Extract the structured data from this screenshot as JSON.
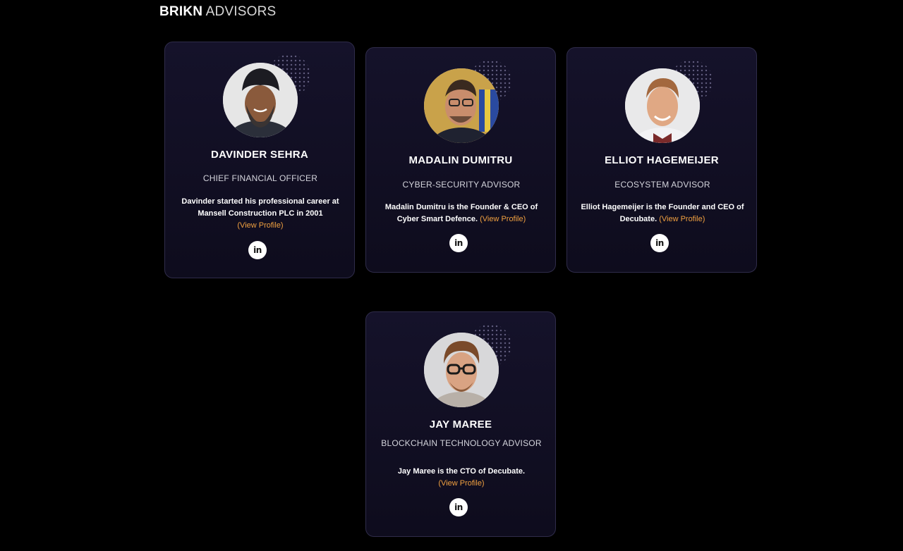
{
  "section": {
    "brand": "BRIKN",
    "title": "ADVISORS"
  },
  "colors": {
    "background": "#000000",
    "card": "#120f24",
    "link": "#f0a040"
  },
  "advisors": [
    {
      "name": "DAVINDER SEHRA",
      "role": "CHIEF FINANCIAL OFFICER",
      "description": "Davinder started his professional career at Mansell Construction PLC in 2001",
      "link_label": "(View Profile)",
      "social_icon": "linkedin-icon",
      "social_label": "in"
    },
    {
      "name": "MADALIN DUMITRU",
      "role": "CYBER-SECURITY ADVISOR",
      "description": "Madalin Dumitru is the Founder & CEO of Cyber Smart Defence.",
      "link_label": "(View Profile)",
      "social_icon": "linkedin-icon",
      "social_label": "in"
    },
    {
      "name": "ELLIOT HAGEMEIJER",
      "role": "ECOSYSTEM ADVISOR",
      "description": "Elliot Hagemeijer is the Founder and CEO of Decubate.",
      "link_label": "(View Profile)",
      "social_icon": "linkedin-icon",
      "social_label": "in"
    },
    {
      "name": "JAY MAREE",
      "role": "BLOCKCHAIN TECHNOLOGY ADVISOR",
      "description": "Jay Maree is the CTO of Decubate.",
      "link_label": "(View Profile)",
      "social_icon": "linkedin-icon",
      "social_label": "in"
    }
  ]
}
